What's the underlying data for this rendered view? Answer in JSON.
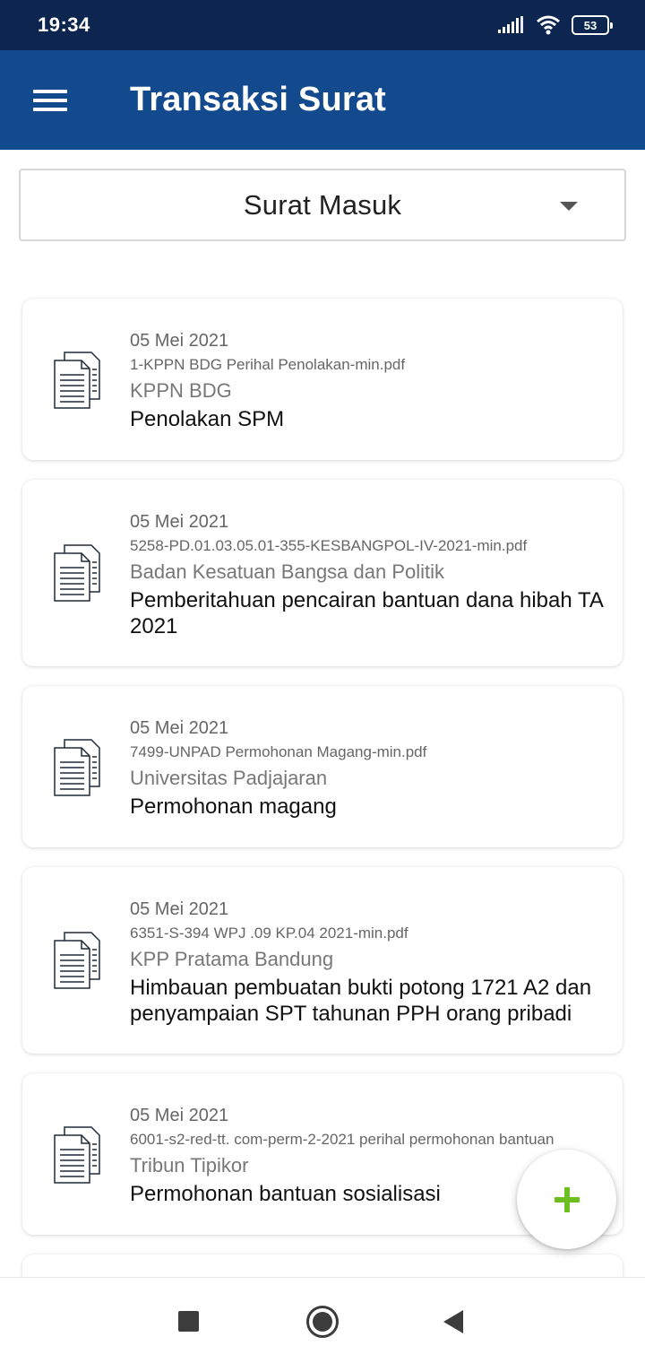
{
  "status_bar": {
    "time": "19:34",
    "battery": "53"
  },
  "app_bar": {
    "title": "Transaksi Surat",
    "menu_icon": "hamburger-menu-icon"
  },
  "filter": {
    "selected": "Surat Masuk",
    "arrow_icon": "dropdown-arrow-icon"
  },
  "letters": [
    {
      "date": "05 Mei 2021",
      "file": "1-KPPN BDG Perihal Penolakan-min.pdf",
      "sender": "KPPN BDG",
      "subject": "Penolakan SPM",
      "icon": "document-icon"
    },
    {
      "date": "05 Mei 2021",
      "file": "5258-PD.01.03.05.01-355-KESBANGPOL-IV-2021-min.pdf",
      "sender": "Badan Kesatuan Bangsa dan Politik",
      "subject": "Pemberitahuan pencairan bantuan dana hibah TA 2021",
      "icon": "document-icon"
    },
    {
      "date": "05 Mei 2021",
      "file": "7499-UNPAD Permohonan Magang-min.pdf",
      "sender": "Universitas Padjajaran",
      "subject": "Permohonan magang",
      "icon": "document-icon"
    },
    {
      "date": "05 Mei 2021",
      "file": "6351-S-394 WPJ .09 KP.04 2021-min.pdf",
      "sender": "KPP Pratama Bandung",
      "subject": "Himbauan pembuatan bukti potong 1721 A2 dan penyampaian SPT tahunan PPH orang pribadi",
      "icon": "document-icon"
    },
    {
      "date": "05 Mei 2021",
      "file": "6001-s2-red-tt. com-perm-2-2021 perihal permohonan bantuan",
      "sender": "Tribun Tipikor",
      "subject": "Permohonan bantuan sosialisasi",
      "icon": "document-icon"
    }
  ],
  "fab": {
    "icon": "plus-icon",
    "color": "#6cbf1e"
  },
  "colors": {
    "status_bar": "#0c2650",
    "app_bar": "#134a8e"
  },
  "nav": {
    "icons": [
      "recents-square-icon",
      "home-circle-icon",
      "back-triangle-icon"
    ]
  }
}
